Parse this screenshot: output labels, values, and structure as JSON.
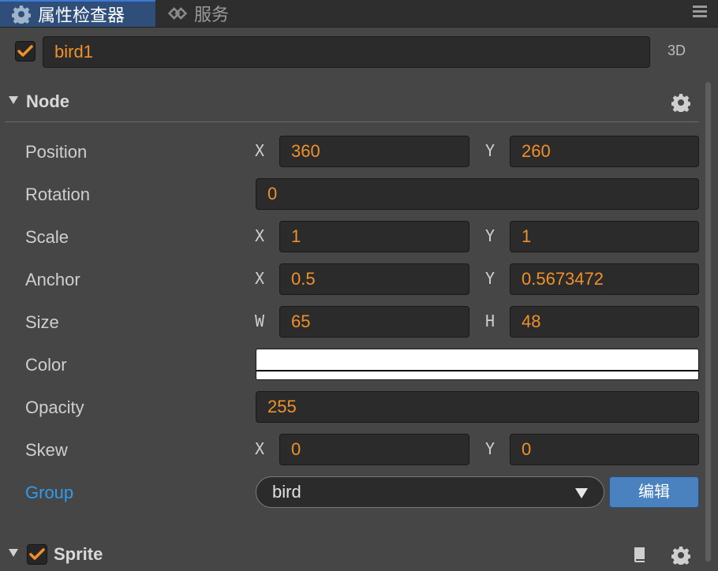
{
  "tabs": [
    {
      "label": "属性检查器",
      "icon": "gear-icon",
      "active": true
    },
    {
      "label": "服务",
      "icon": "services-icon",
      "active": false
    }
  ],
  "header": {
    "enabled": true,
    "node_name": "bird1",
    "mode_label": "3D"
  },
  "node_section": {
    "title": "Node",
    "position": {
      "label": "Position",
      "x_axis": "X",
      "x": "360",
      "y_axis": "Y",
      "y": "260"
    },
    "rotation": {
      "label": "Rotation",
      "value": "0"
    },
    "scale": {
      "label": "Scale",
      "x_axis": "X",
      "x": "1",
      "y_axis": "Y",
      "y": "1"
    },
    "anchor": {
      "label": "Anchor",
      "x_axis": "X",
      "x": "0.5",
      "y_axis": "Y",
      "y": "0.5673472"
    },
    "size": {
      "label": "Size",
      "w_axis": "W",
      "w": "65",
      "h_axis": "H",
      "h": "48"
    },
    "color": {
      "label": "Color",
      "value": "#ffffff"
    },
    "opacity": {
      "label": "Opacity",
      "value": "255"
    },
    "skew": {
      "label": "Skew",
      "x_axis": "X",
      "x": "0",
      "y_axis": "Y",
      "y": "0"
    },
    "group": {
      "label": "Group",
      "selected": "bird",
      "edit_label": "编辑"
    }
  },
  "sprite_section": {
    "title": "Sprite",
    "enabled": true
  },
  "colors": {
    "accent_orange": "#f0902a",
    "link_blue": "#2f9bf0",
    "active_tab": "#2f4f7a",
    "edit_button": "#4a82c0"
  }
}
